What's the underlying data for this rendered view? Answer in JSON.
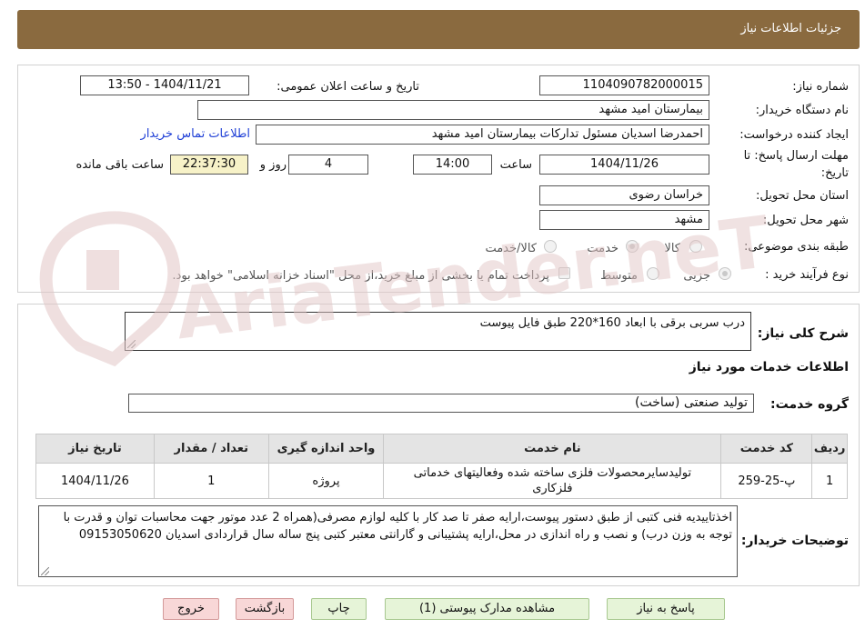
{
  "header": {
    "title": "جزئیات اطلاعات نیاز"
  },
  "form": {
    "need_number_label": "شماره نیاز:",
    "need_number": "1104090782000015",
    "announce_label": "تاریخ و ساعت اعلان عمومی:",
    "announce_value": "1404/11/21 - 13:50",
    "buyer_org_label": "نام دستگاه خریدار:",
    "buyer_org": "بیمارستان امید مشهد",
    "requester_label": "ایجاد کننده درخواست:",
    "requester": "احمدرضا اسدیان مسئول تدارکات بیمارستان امید مشهد",
    "contact_link": "اطلاعات تماس خریدار",
    "deadline_label_line1": "مهلت ارسال پاسخ: تا",
    "deadline_label_line2": "تاریخ:",
    "deadline_date": "1404/11/26",
    "time_label": "ساعت",
    "deadline_time": "14:00",
    "days_value": "4",
    "days_label": "روز و",
    "remaining_time": "22:37:30",
    "remaining_label": "ساعت باقی مانده",
    "province_label": "استان محل تحویل:",
    "province": "خراسان رضوی",
    "city_label": "شهر محل تحویل:",
    "city": "مشهد",
    "category_label": "طبقه بندی موضوعی:",
    "category_options": [
      "کالا",
      "خدمت",
      "کالا/خدمت"
    ],
    "process_label": "نوع فرآیند خرید :",
    "process_options": [
      "جزیی",
      "متوسط"
    ],
    "payment_note": "پرداخت تمام یا بخشی از مبلغ خرید،از محل \"اسناد خزانه اسلامی\" خواهد بود."
  },
  "details": {
    "summary_label": "شرح کلی نیاز:",
    "summary": "درب سربی برقی با ابعاد 160*220 طبق فایل پیوست",
    "services_heading": "اطلاعات خدمات مورد نیاز",
    "service_group_label": "گروه خدمت:",
    "service_group": "تولید صنعتی (ساخت)"
  },
  "table": {
    "headers": [
      "ردیف",
      "کد خدمت",
      "نام خدمت",
      "واحد اندازه گیری",
      "تعداد / مقدار",
      "تاریخ نیاز"
    ],
    "rows": [
      {
        "row": "1",
        "code": "پ-25-259",
        "name": "تولیدسایرمحصولات فلزی ساخته شده وفعالیتهای خدماتی فلزکاری",
        "unit": "پروژه",
        "qty": "1",
        "date": "1404/11/26"
      }
    ]
  },
  "buyer_notes": {
    "label": "توضیحات خریدار:",
    "text": "اخذتاییدیه فنی کتبی از طبق دستور پیوست،ارایه صفر تا صد کار با کلیه لوازم مصرفی(همراه 2 عدد موتور جهت محاسبات توان و قدرت با توجه به وزن درب) و نصب و راه اندازی در محل،ارایه پشتیبانی و گارانتی معتبر کتبی پنج ساله سال قراردادی اسدیان 09153050620"
  },
  "buttons": {
    "reply": "پاسخ به نیاز",
    "attachments": "مشاهده مدارک پیوستی (1)",
    "print": "چاپ",
    "back": "بازگشت",
    "exit": "خروج"
  },
  "watermark": {
    "text": "AriaTender.neT"
  },
  "colors": {
    "header_bg": "#8a6a3f",
    "time_bg": "#f7f2c8",
    "link": "#1f3fd6",
    "button_green": "#e6f4d8",
    "button_red": "#f8d7d7",
    "watermark": "#e2c6c6"
  }
}
